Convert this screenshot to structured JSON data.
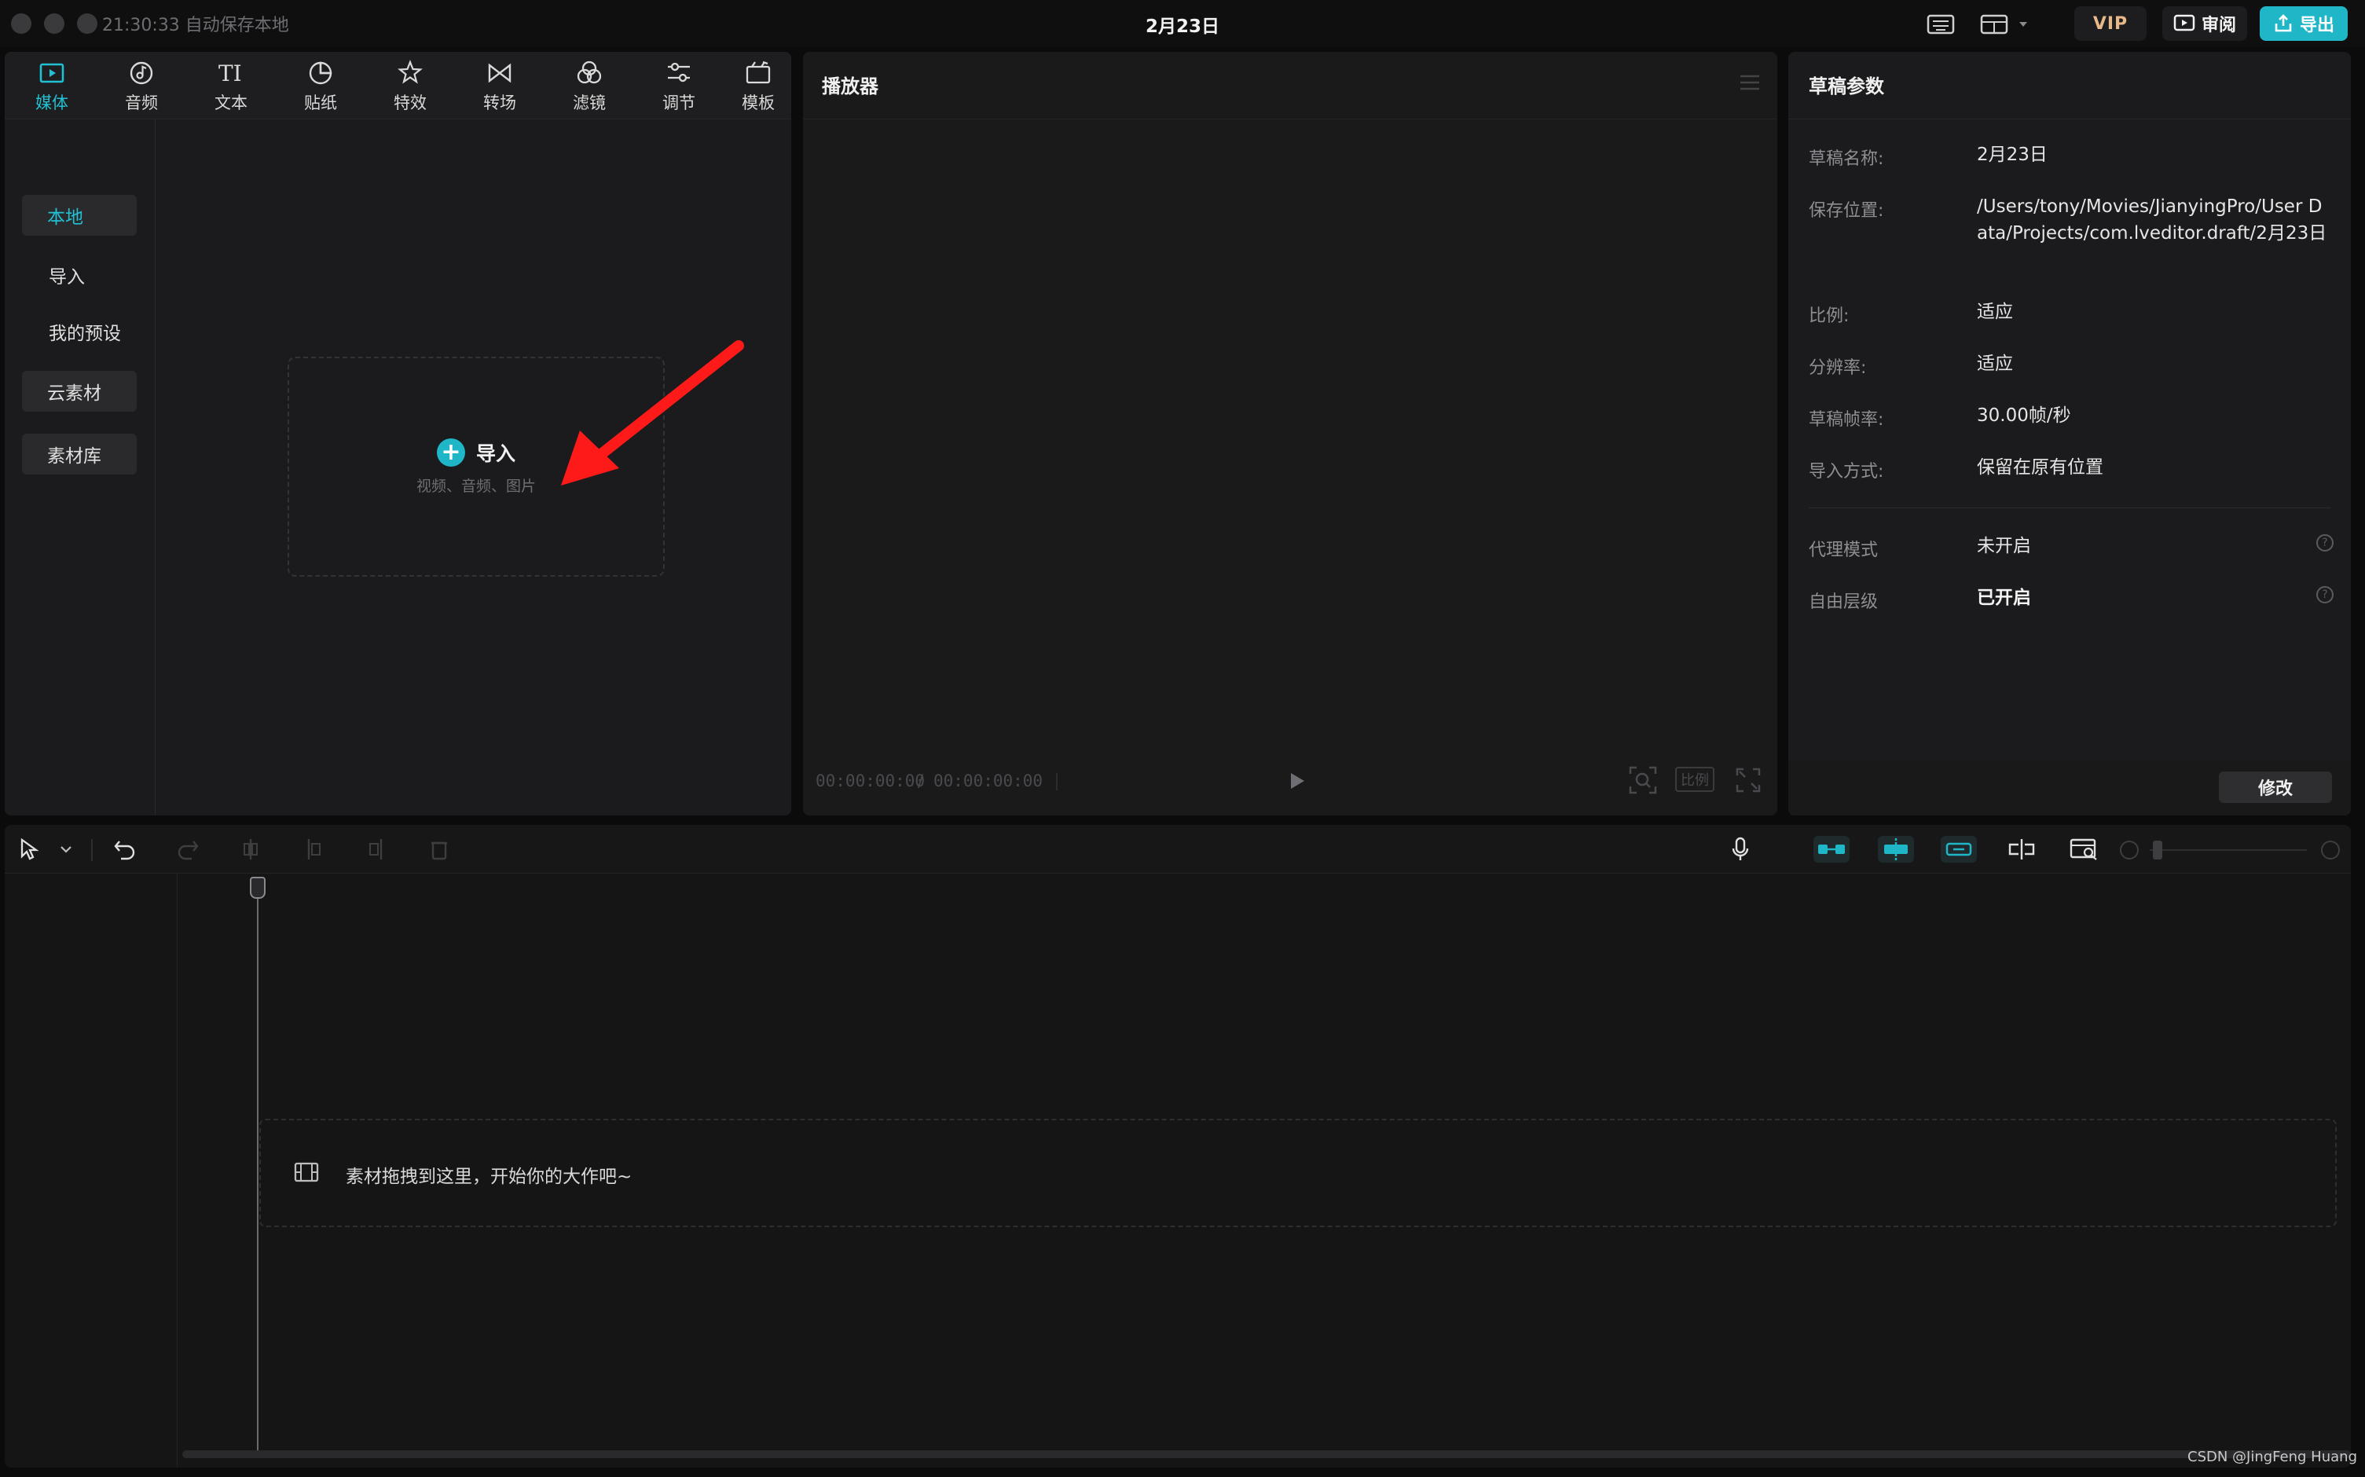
{
  "window": {
    "status": "21:30:33 自动保存本地",
    "title": "2月23日",
    "vip_label": "VIP",
    "review_label": "审阅",
    "export_label": "导出"
  },
  "media": {
    "tabs": [
      {
        "label": "媒体",
        "icon": "media-icon"
      },
      {
        "label": "音频",
        "icon": "audio-icon"
      },
      {
        "label": "文本",
        "icon": "text-icon"
      },
      {
        "label": "贴纸",
        "icon": "sticker-icon"
      },
      {
        "label": "特效",
        "icon": "effects-icon"
      },
      {
        "label": "转场",
        "icon": "transition-icon"
      },
      {
        "label": "滤镜",
        "icon": "filter-icon"
      },
      {
        "label": "调节",
        "icon": "adjust-icon"
      },
      {
        "label": "模板",
        "icon": "template-icon"
      }
    ],
    "sidebar": {
      "local": "本地",
      "import": "导入",
      "presets": "我的预设",
      "cloud": "云素材",
      "library": "素材库"
    },
    "import_box": {
      "label": "导入",
      "hint": "视频、音频、图片"
    }
  },
  "player": {
    "title": "播放器",
    "time_current": "00:00:00:00",
    "time_separator": "/",
    "time_total": "00:00:00:00",
    "ratio_label": "比例"
  },
  "draft": {
    "title": "草稿参数",
    "rows": [
      {
        "label": "草稿名称:",
        "value": "2月23日"
      },
      {
        "label": "保存位置:",
        "value": "/Users/tony/Movies/JianyingPro/User Data/Projects/com.lveditor.draft/2月23日"
      },
      {
        "label": "比例:",
        "value": "适应"
      },
      {
        "label": "分辨率:",
        "value": "适应"
      },
      {
        "label": "草稿帧率:",
        "value": "30.00帧/秒"
      },
      {
        "label": "导入方式:",
        "value": "保留在原有位置"
      }
    ],
    "extra_rows": [
      {
        "label": "代理模式",
        "value": "未开启"
      },
      {
        "label": "自由层级",
        "value": "已开启"
      }
    ],
    "modify_label": "修改"
  },
  "timeline": {
    "drop_hint": "素材拖拽到这里，开始你的大作吧~"
  },
  "watermark": "CSDN @JingFeng Huang",
  "colors": {
    "accent": "#1fb6c8",
    "arrow": "#ff1a1a"
  }
}
